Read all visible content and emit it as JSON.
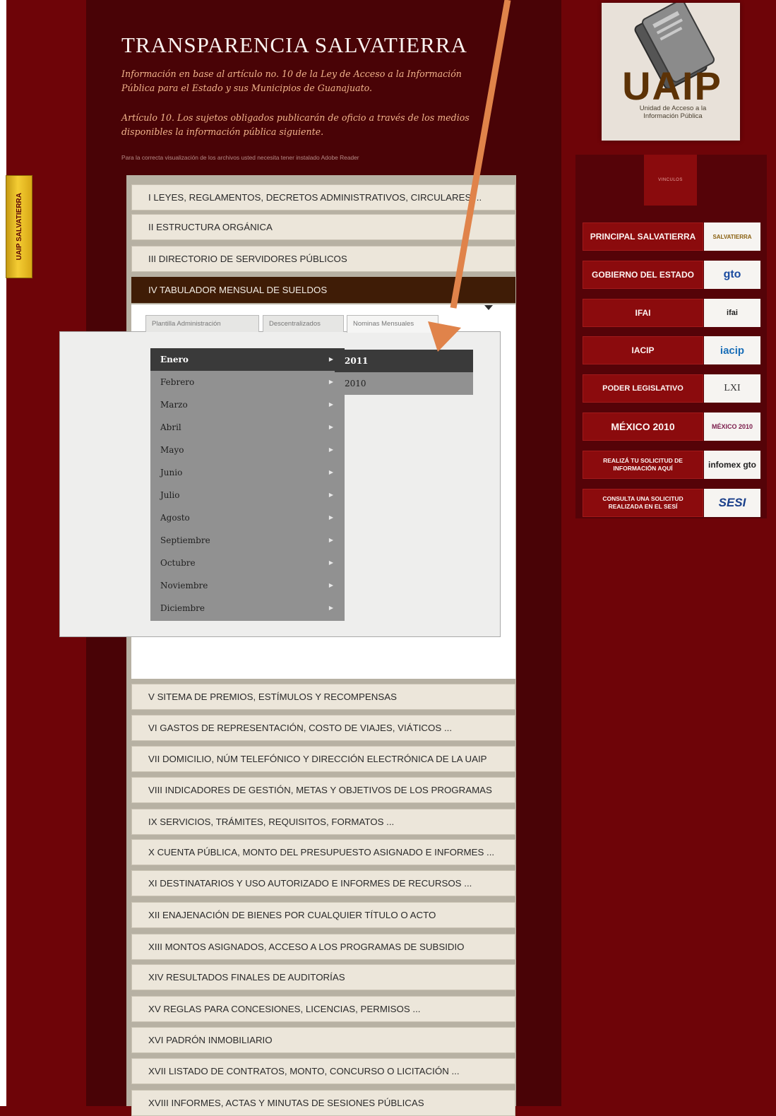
{
  "side_tab": {
    "label": "UAIP SALVATIERRA"
  },
  "header": {
    "title": "TRANSPARENCIA SALVATIERRA",
    "intro": "Información en base al artículo no. 10 de la Ley de Acceso a la Información Pública para el Estado y sus Municipios de Guanajuato.",
    "article": "Artículo 10. Los sujetos obligados publicarán de oficio a través de los medios disponibles la información pública siguiente.",
    "notice": "Para la correcta visualización de los archivos usted necesita tener instalado Adobe Reader"
  },
  "menu": {
    "items": [
      {
        "label": "I LEYES, REGLAMENTOS, DECRETOS ADMINISTRATIVOS, CIRCULARES ..."
      },
      {
        "label": "II ESTRUCTURA ORGÁNICA"
      },
      {
        "label": "III DIRECTORIO DE SERVIDORES PÚBLICOS"
      },
      {
        "label": "IV TABULADOR MENSUAL DE SUELDOS",
        "active": true
      },
      {
        "label": "V SITEMA DE PREMIOS, ESTÍMULOS Y RECOMPENSAS"
      },
      {
        "label": "VI GASTOS DE REPRESENTACIÓN, COSTO DE VIAJES, VIÁTICOS ..."
      },
      {
        "label": "VII DOMICILIO, NÚM TELEFÓNICO Y DIRECCIÓN ELECTRÓNICA DE LA UAIP"
      },
      {
        "label": "VIII INDICADORES DE GESTIÓN, METAS Y OBJETIVOS DE LOS PROGRAMAS"
      },
      {
        "label": "IX SERVICIOS, TRÁMITES, REQUISITOS, FORMATOS ..."
      },
      {
        "label": "X CUENTA PÚBLICA, MONTO DEL PRESUPUESTO ASIGNADO E INFORMES ..."
      },
      {
        "label": "XI DESTINATARIOS Y USO AUTORIZADO E INFORMES DE RECURSOS ..."
      },
      {
        "label": "XII ENAJENACIÓN DE BIENES POR CUALQUIER TÍTULO O ACTO"
      },
      {
        "label": "XIII MONTOS ASIGNADOS, ACCESO A LOS PROGRAMAS DE SUBSIDIO"
      },
      {
        "label": "XIV RESULTADOS FINALES DE AUDITORÍAS"
      },
      {
        "label": "XV REGLAS PARA CONCESIONES, LICENCIAS, PERMISOS ..."
      },
      {
        "label": "XVI PADRÓN INMOBILIARIO"
      },
      {
        "label": "XVII LISTADO DE CONTRATOS, MONTO, CONCURSO O LICITACIÓN ..."
      },
      {
        "label": "XVIII INFORMES, ACTAS Y MINUTAS DE SESIONES PÚBLICAS"
      }
    ]
  },
  "tabs": [
    {
      "label": "Plantilla Administración"
    },
    {
      "label": "Descentralizados"
    },
    {
      "label": "Nominas Mensuales",
      "selected": true
    }
  ],
  "months": [
    {
      "label": "Enero",
      "highlighted": true
    },
    {
      "label": "Febrero"
    },
    {
      "label": "Marzo"
    },
    {
      "label": "Abril"
    },
    {
      "label": "Mayo"
    },
    {
      "label": "Junio"
    },
    {
      "label": "Julio"
    },
    {
      "label": "Agosto"
    },
    {
      "label": "Septiembre"
    },
    {
      "label": "Octubre"
    },
    {
      "label": "Noviembre"
    },
    {
      "label": "Diciembre"
    }
  ],
  "submenu_arrow_icon": "triangle-right-icon",
  "years": [
    {
      "label": "2011",
      "highlighted": true
    },
    {
      "label": "2010"
    }
  ],
  "logo": {
    "text": "UAIP",
    "subtitle": "Unidad de Acceso a la Información Pública"
  },
  "links": {
    "header": "VINCULOS",
    "items": [
      {
        "label": "PRINCIPAL SALVATIERRA",
        "logo": "SALVATIERRA"
      },
      {
        "label": "GOBIERNO DEL ESTADO",
        "logo": "gto"
      },
      {
        "label": "IFAI",
        "logo": "ifai"
      },
      {
        "label": "IACIP",
        "logo": "iacip"
      },
      {
        "label": "PODER LEGISLATIVO",
        "logo": "LXI"
      },
      {
        "label": "MÉXICO 2010",
        "logo": "MÉXICO 2010"
      },
      {
        "label": "REALIZÁ TU SOLICITUD DE INFORMACIÓN AQUÍ",
        "logo": "infomex gto"
      },
      {
        "label": "CONSULTA UNA SOLICITUD REALIZADA EN EL SESÍ",
        "logo": "SESI"
      }
    ]
  },
  "colors": {
    "page_background": "#6e0408",
    "main_background": "#490306",
    "active_item": "#3f1c06",
    "menu_item": "#ece6da",
    "dropdown": "#919191",
    "dropdown_highlight": "#3a3a3a",
    "annotation_arrow": "#e0834a",
    "link_button": "#8b0b0d"
  }
}
